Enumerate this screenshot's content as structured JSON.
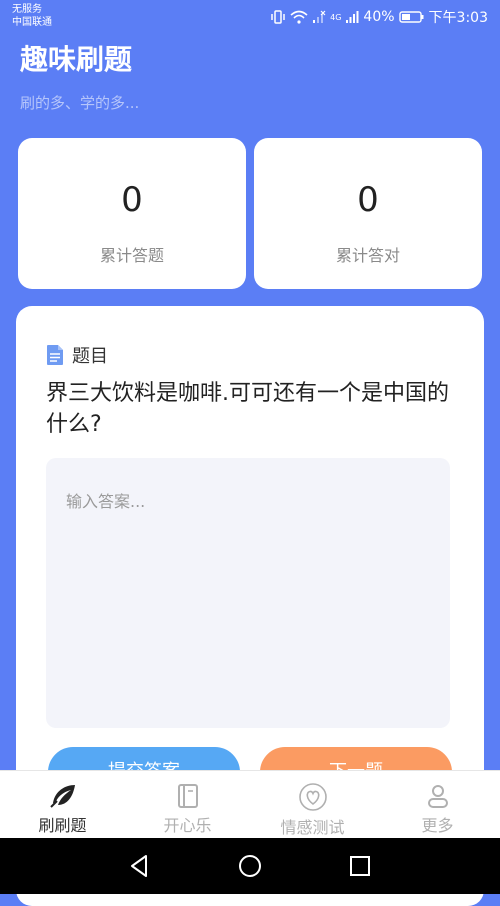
{
  "status_bar": {
    "carrier_line1": "无服务",
    "carrier_line2": "中国联通",
    "network_label": "4G",
    "battery": "40%",
    "time": "下午3:03"
  },
  "header": {
    "title": "趣味刷题",
    "subtitle": "刷的多、学的多..."
  },
  "stats": [
    {
      "value": "0",
      "label": "累计答题"
    },
    {
      "value": "0",
      "label": "累计答对"
    }
  ],
  "question": {
    "header_label": "题目",
    "text": "界三大饮料是咖啡.可可还有一个是中国的什么?",
    "answer_placeholder": "输入答案...",
    "submit_label": "提交答案",
    "next_label": "下一题"
  },
  "tabs": [
    {
      "label": "刷刷题",
      "icon": "feather-icon",
      "active": true
    },
    {
      "label": "开心乐",
      "icon": "notebook-icon",
      "active": false
    },
    {
      "label": "情感测试",
      "icon": "heart-icon",
      "active": false
    },
    {
      "label": "更多",
      "icon": "person-icon",
      "active": false
    }
  ],
  "colors": {
    "background": "#5b7ef5",
    "submit_button": "#56a8f4",
    "next_button": "#fb9b62"
  }
}
